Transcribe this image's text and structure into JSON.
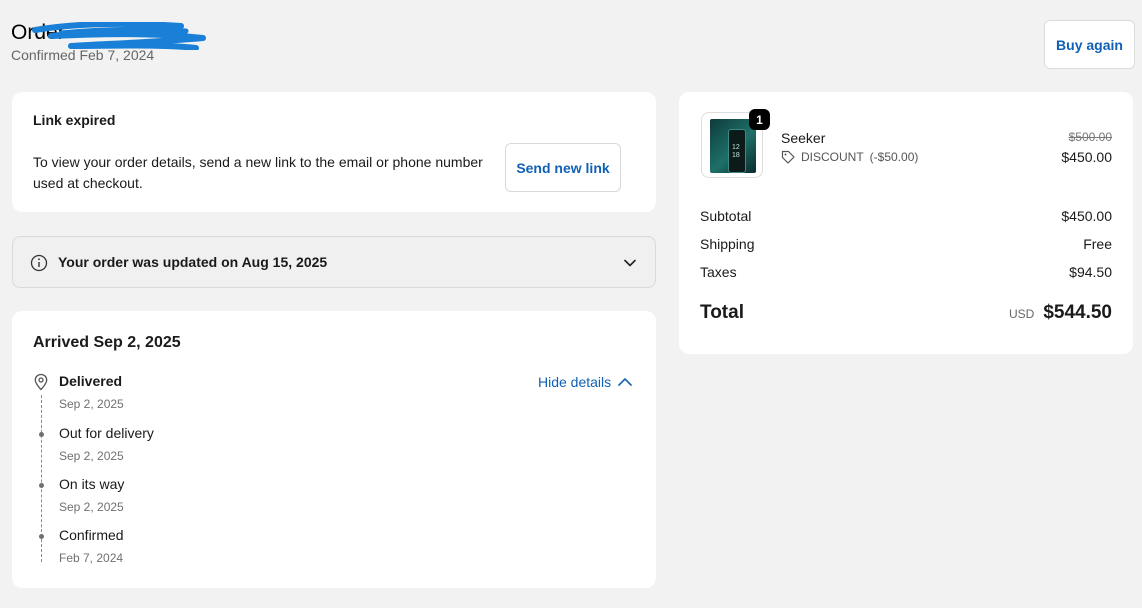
{
  "header": {
    "order_title": "Order",
    "confirmed": "Confirmed Feb 7, 2024",
    "buy_again": "Buy again"
  },
  "link_expired": {
    "title": "Link expired",
    "text": "To view your order details, send a new link to the email or phone number used at checkout.",
    "button": "Send new link"
  },
  "update_notice": {
    "text": "Your order was updated on Aug 15, 2025"
  },
  "tracking": {
    "title": "Arrived Sep 2, 2025",
    "hide_details": "Hide details",
    "events": [
      {
        "label": "Delivered",
        "date": "Sep 2, 2025"
      },
      {
        "label": "Out for delivery",
        "date": "Sep 2, 2025"
      },
      {
        "label": "On its way",
        "date": "Sep 2, 2025"
      },
      {
        "label": "Confirmed",
        "date": "Feb 7, 2024"
      }
    ]
  },
  "summary": {
    "product": {
      "name": "Seeker",
      "quantity": "1",
      "discount": "DISCOUNT",
      "discount_amount": "(-$50.00)",
      "original_price": "$500.00",
      "price": "$450.00",
      "thumb_text": "12\n18"
    },
    "rows": [
      {
        "label": "Subtotal",
        "value": "$450.00"
      },
      {
        "label": "Shipping",
        "value": "Free"
      },
      {
        "label": "Taxes",
        "value": "$94.50"
      }
    ],
    "total_label": "Total",
    "currency": "USD",
    "total": "$544.50"
  },
  "colors": {
    "accent": "#1061b5",
    "background": "#f2f2f2",
    "redaction": "#1a7fd6"
  }
}
